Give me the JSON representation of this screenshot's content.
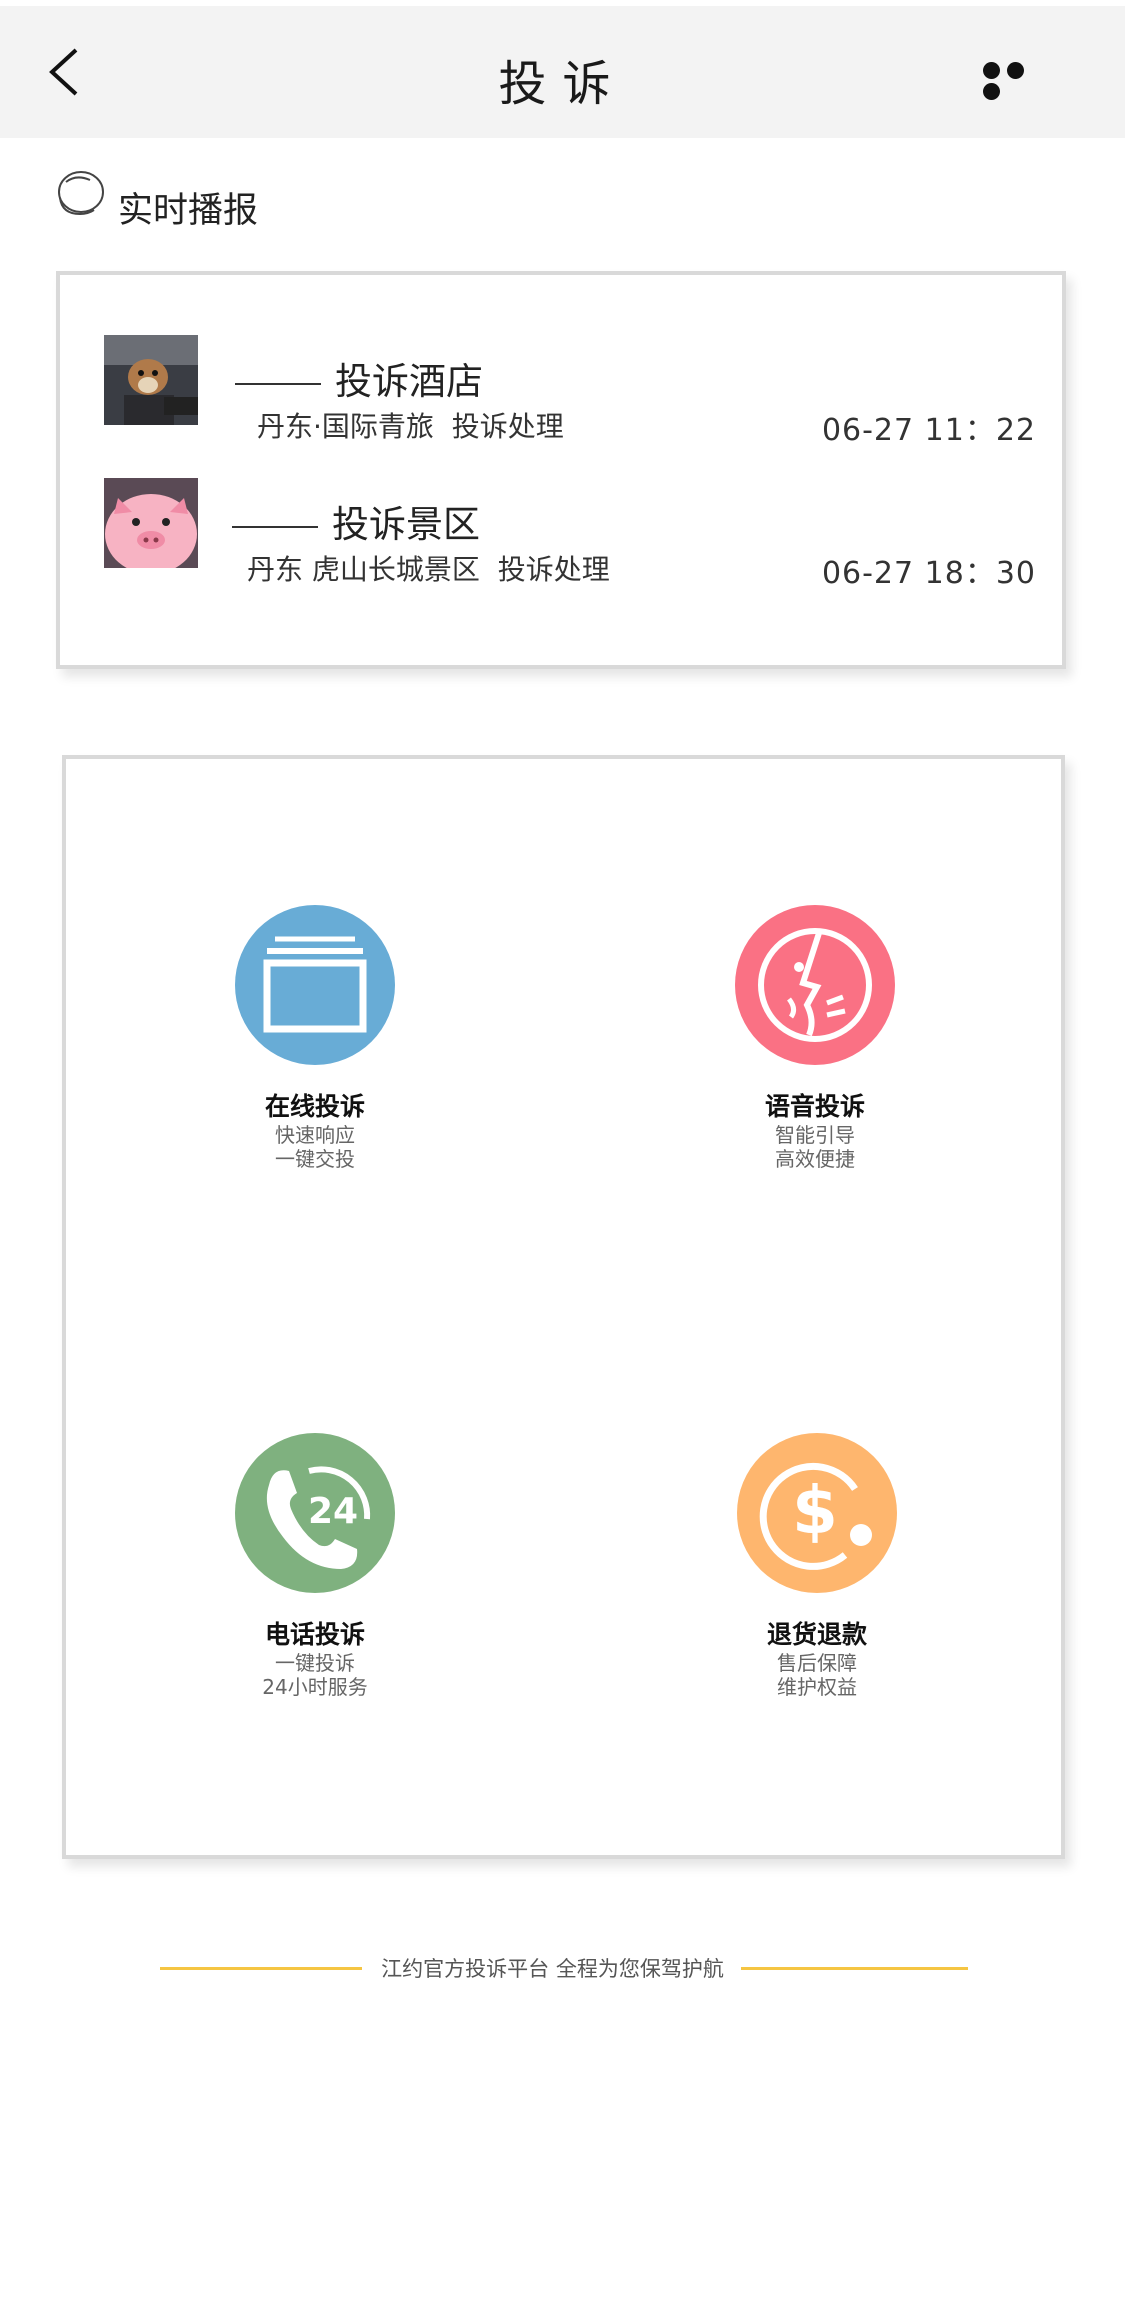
{
  "header": {
    "title": "投诉"
  },
  "live": {
    "title": "实时播报"
  },
  "broadcasts": [
    {
      "title": "投诉酒店",
      "location": "丹东·国际青旅",
      "status": "投诉处理",
      "time": "06-27  11：22"
    },
    {
      "title": "投诉景区",
      "location": "丹东 虎山长城景区",
      "status": "投诉处理",
      "time": "06-27  18：30"
    }
  ],
  "services": [
    {
      "label": "在线投诉",
      "line1": "快速响应",
      "line2": "一键交投",
      "color": "#68acd6",
      "icon": "window-icon"
    },
    {
      "label": "语音投诉",
      "line1": "智能引导",
      "line2": "高效便捷",
      "color": "#fa7184",
      "icon": "face-voice-icon"
    },
    {
      "label": "电话投诉",
      "line1": "一键投诉",
      "line2": "24小时服务",
      "color": "#7fb17f",
      "icon": "phone-24-icon",
      "badge": "24"
    },
    {
      "label": "退货退款",
      "line1": "售后保障",
      "line2": "维护权益",
      "color": "#feb66e",
      "icon": "dollar-refund-icon",
      "symbol": "$"
    }
  ],
  "footer": {
    "text": "江约官方投诉平台 全程为您保驾护航",
    "line_color": "#f5c542"
  }
}
